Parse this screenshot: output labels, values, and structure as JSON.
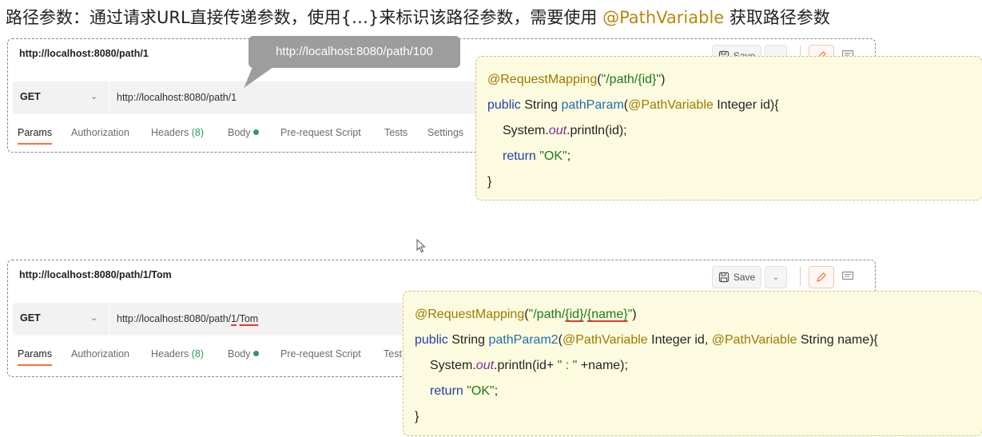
{
  "heading": {
    "prefix": "路径参数：通过请求URL直接传递参数，使用{…}来标识该路径参数，需要使用 ",
    "highlight": "@PathVariable",
    "suffix": " 获取路径参数",
    "highlight_color": "#b8860b"
  },
  "tooltip": {
    "text": "http://localhost:8080/path/100"
  },
  "panel1": {
    "request_title": "http://localhost:8080/path/1",
    "save_label": "Save",
    "method": "GET",
    "url": "http://localhost:8080/path/1",
    "tabs": [
      {
        "label": "Params"
      },
      {
        "label": "Authorization"
      },
      {
        "label": "Headers",
        "count": "(8)"
      },
      {
        "label": "Body"
      },
      {
        "label": "Pre-request Script"
      },
      {
        "label": "Tests"
      },
      {
        "label": "Settings"
      }
    ]
  },
  "panel2": {
    "request_title": "http://localhost:8080/path/1/Tom",
    "save_label": "Save",
    "method": "GET",
    "url_prefix": "http://localhost:8080/path/",
    "url_seg1": "1",
    "url_slash": "/",
    "url_seg2": "Tom",
    "tabs": [
      {
        "label": "Params"
      },
      {
        "label": "Authorization"
      },
      {
        "label": "Headers",
        "count": "(8)"
      },
      {
        "label": "Body"
      },
      {
        "label": "Pre-request Script"
      },
      {
        "label": "Test"
      }
    ]
  },
  "code1": {
    "line1": {
      "ann": "@RequestMapping",
      "open": "(",
      "str": "\"/path/{id}\"",
      "close": ")"
    },
    "line2": {
      "kw": "public",
      "type": " String ",
      "fn": "pathParam",
      "open": "(",
      "ann": "@PathVariable",
      "rest": " Integer id){"
    },
    "line3": {
      "pre": "System.",
      "ital": "out",
      "post": ".println(id);"
    },
    "line4": {
      "kw": "return",
      "str": " \"OK\"",
      "end": ";"
    },
    "line5": "}"
  },
  "code2": {
    "line1": {
      "ann": "@RequestMapping",
      "open": "(",
      "str_a": "\"/path/",
      "seg1": "{id}",
      "slash": "/",
      "seg2": "{name}",
      "str_b": "\"",
      "close": ")"
    },
    "line2": {
      "kw": "public",
      "type": " String ",
      "fn": "pathParam2",
      "open": "(",
      "ann1": "@PathVariable",
      "mid": " Integer id, ",
      "ann2": "@PathVariable",
      "rest": " String name){"
    },
    "line3": {
      "pre": "System.",
      "ital": "out",
      "post": ".println(id+",
      "str": " \" : \" ",
      "end": "+name);"
    },
    "line4": {
      "kw": "return",
      "str": " \"OK\"",
      "end": ";"
    },
    "line5": "}"
  },
  "icons": {
    "save": "save-icon",
    "dropdown": "chevron-down-icon",
    "edit": "pencil-icon",
    "comment": "comment-icon",
    "cursor": "mouse-cursor-icon"
  },
  "colors": {
    "active_tab_underline": "#ff6c37",
    "headers_count": "#2a9d5c",
    "code_background": "#fdfbdf",
    "annotation": "#9a7b00",
    "string": "#1b7a1b",
    "keyword": "#1f3fa8",
    "underline_mark": "#e53935"
  }
}
